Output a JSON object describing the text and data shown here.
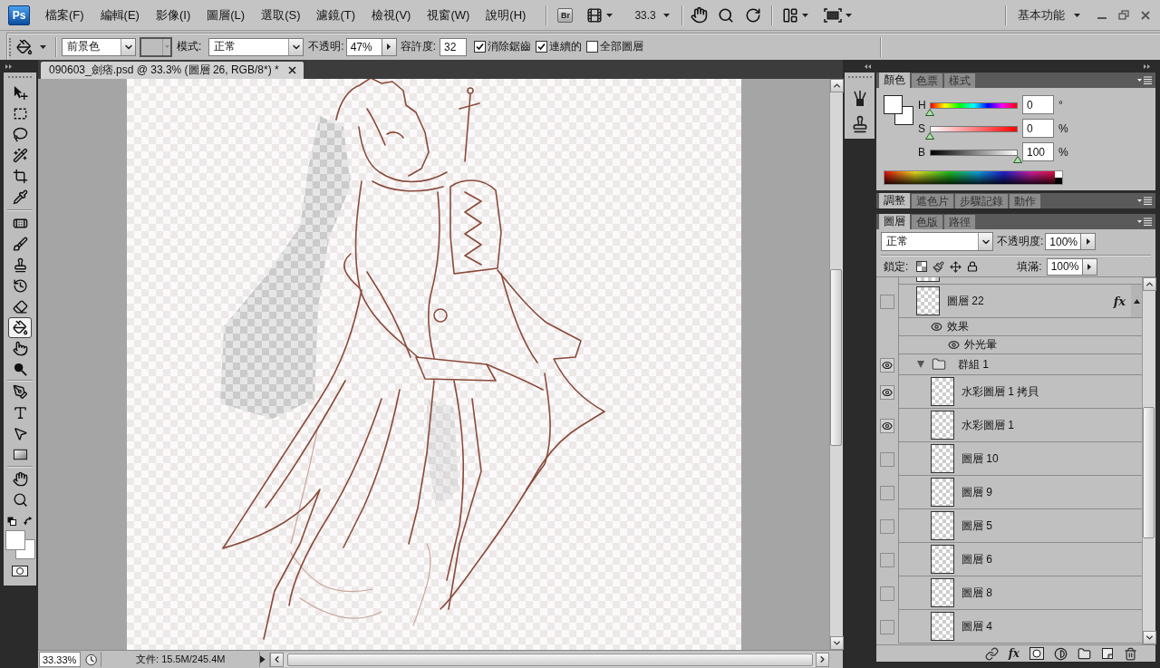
{
  "app_bar": {
    "logo": "Ps",
    "menus": [
      "檔案(F)",
      "編輯(E)",
      "影像(I)",
      "圖層(L)",
      "選取(S)",
      "濾鏡(T)",
      "檢視(V)",
      "視窗(W)",
      "說明(H)"
    ],
    "bridge": "Br",
    "zoom": "33.3",
    "workspace": "基本功能"
  },
  "options_bar": {
    "fill_source": "前景色",
    "pattern_picker": {
      "disabled": true
    },
    "mode_label": "模式:",
    "mode": "正常",
    "opacity_label": "不透明:",
    "opacity": "47%",
    "tolerance_label": "容許度:",
    "tolerance": "32",
    "checkboxes": [
      {
        "label": "消除鋸齒",
        "checked": true
      },
      {
        "label": "連續的",
        "checked": true
      },
      {
        "label": "全部圖層",
        "checked": false
      }
    ]
  },
  "tools": {
    "groups": [
      [
        {
          "selected": false
        },
        {
          "selected": false
        },
        {
          "selected": false
        },
        {
          "selected": false
        },
        {
          "selected": false
        },
        {
          "selected": false
        }
      ],
      [
        {
          "selected": false
        },
        {
          "selected": false
        },
        {
          "selected": false
        },
        {
          "selected": false
        },
        {
          "selected": false
        },
        {
          "selected": true
        },
        {
          "selected": false
        },
        {
          "selected": false
        }
      ],
      [
        {
          "selected": false
        },
        {
          "selected": false
        },
        {
          "selected": false
        },
        {
          "selected": false
        }
      ],
      [
        {
          "selected": false
        },
        {
          "selected": false
        }
      ]
    ],
    "swatches": [
      {
        "color": "#ffffff"
      },
      {
        "color": "#ffffff"
      }
    ]
  },
  "document_tabs": [
    {
      "title": "090603_劍痞.psd @ 33.3% (圖層 26, RGB/8*) *",
      "selected": true
    }
  ],
  "status_bar": {
    "zoom": "33.33%",
    "info": "文件: 15.5M/245.4M"
  },
  "color_panel": {
    "tabs": [
      {
        "label": "顏色",
        "selected": true
      },
      {
        "label": "色票",
        "selected": false
      },
      {
        "label": "樣式",
        "selected": false
      }
    ],
    "swatches": [
      {
        "color": "#ffffff"
      },
      {
        "color": "#ffffff"
      }
    ],
    "channels": [
      {
        "label": "H",
        "level": 0,
        "value": "0",
        "unit": "°"
      },
      {
        "label": "S",
        "level": 0,
        "value": "0",
        "unit": "%"
      },
      {
        "label": "B",
        "level": 1,
        "value": "100",
        "unit": "%"
      }
    ]
  },
  "adjustments_panel": {
    "tabs": [
      {
        "label": "調整",
        "selected": true
      },
      {
        "label": "遮色片",
        "selected": false
      },
      {
        "label": "步驟記錄",
        "selected": false
      },
      {
        "label": "動作",
        "selected": false
      }
    ]
  },
  "layers_panel": {
    "tabs": [
      {
        "label": "圖層",
        "selected": true
      },
      {
        "label": "色版",
        "selected": false
      },
      {
        "label": "路徑",
        "selected": false
      }
    ],
    "blend_mode": "正常",
    "opacity_label": "不透明度:",
    "opacity": "100%",
    "lock_label": "鎖定:",
    "fill_label": "填滿:",
    "fill": "100%",
    "style_button": "fx",
    "layers": [
      {
        "kind": "layer",
        "name": "圖層 22",
        "visible": false,
        "selected": false,
        "badge": "fx",
        "expanded": true,
        "children": [
          {
            "kind": "effects",
            "name": "效果",
            "visible": true,
            "children": [
              {
                "kind": "effect",
                "name": "外光暈",
                "visible": true
              }
            ]
          }
        ]
      },
      {
        "kind": "group",
        "name": "群組 1",
        "visible": true,
        "selected": false,
        "expanded": true,
        "children": [
          {
            "kind": "layer",
            "name": "水彩圖層 1 拷貝",
            "visible": true,
            "selected": false
          },
          {
            "kind": "layer",
            "name": "水彩圖層 1",
            "visible": true,
            "selected": false
          },
          {
            "kind": "layer",
            "name": "圖層 10",
            "visible": false,
            "selected": false
          },
          {
            "kind": "layer",
            "name": "圖層 9",
            "visible": false,
            "selected": false
          },
          {
            "kind": "layer",
            "name": "圖層 5",
            "visible": false,
            "selected": false
          },
          {
            "kind": "layer",
            "name": "圖層 6",
            "visible": false,
            "selected": false
          },
          {
            "kind": "layer",
            "name": "圖層 8",
            "visible": false,
            "selected": false
          },
          {
            "kind": "layer",
            "name": "圖層 4",
            "visible": false,
            "selected": false
          }
        ]
      }
    ]
  }
}
